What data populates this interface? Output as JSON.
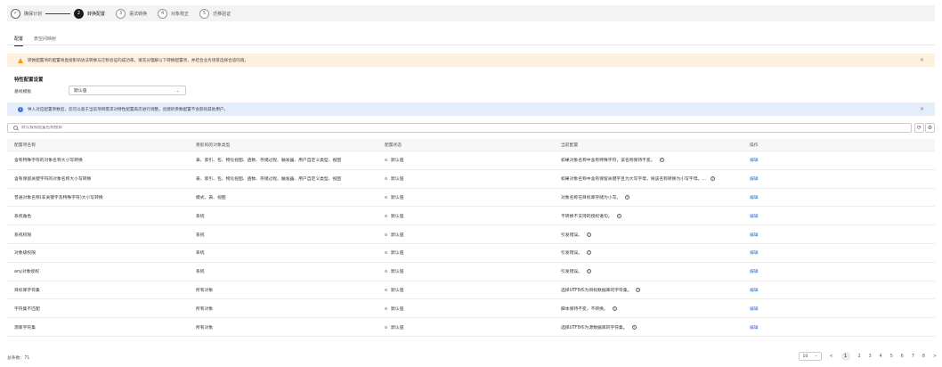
{
  "stepper": {
    "steps": [
      {
        "num": "✓",
        "label": "确保计划"
      },
      {
        "num": "2",
        "label": "转换配置"
      },
      {
        "num": "3",
        "label": "语法转换"
      },
      {
        "num": "4",
        "label": "对象校正"
      },
      {
        "num": "5",
        "label": "迁移验证"
      }
    ]
  },
  "tabs": [
    {
      "label": "配置"
    },
    {
      "label": "表空间映射"
    }
  ],
  "warning_banner": {
    "text": "转换配置项的配置将直接影响语法转换与迁移验证的成功率。请充分理解以下转换配置项，并结合业务场景选择合适的值。",
    "close": "×"
  },
  "section": {
    "title": "特性配置设置",
    "field_label": "基线模板",
    "select_value": "默认值",
    "select_chevron": "⌄"
  },
  "info_banner": {
    "icon": "i",
    "text": "导入对应配置参数后，您可以基于当前项目需求对特性配置再次进行调整，创建的参数配置不会影响其他用户。",
    "close": "×"
  },
  "search": {
    "placeholder": "默认按照配置名称搜索",
    "refresh_icon": "⟳",
    "settings_icon": "⚙"
  },
  "table": {
    "headers": [
      "配置项名称",
      "受影响的对象类型",
      "配置状态",
      "当前配置",
      "操作"
    ],
    "rows": [
      {
        "name": "含有特殊字符的对象名称大小写转换",
        "types": "表、索引、包、物化视图、函数、存储过程、触发器、用户自定义类型、视图",
        "status": "默认值",
        "current": "如果对象名称中含有特殊字符，该名称保持不变。",
        "help": "?",
        "action": "编辑"
      },
      {
        "name": "含有保留关键字符的对象名称大小写转换",
        "types": "表、索引、包、物化视图、函数、存储过程、触发器、用户自定义类型、视图",
        "status": "默认值",
        "current": "如果对象名称中含有保留关键字且为大写字母，将该名称转换为小写字母。...",
        "help": "?",
        "action": "编辑"
      },
      {
        "name": "普通对象名称(非关键字及特殊字符)大小写转换",
        "types": "模式、表、视图",
        "status": "默认值",
        "current": "对象名称在目标库存储为小写。",
        "help": "?",
        "action": "编辑"
      },
      {
        "name": "系统角色",
        "types": "系统",
        "status": "默认值",
        "current": "不转换不支持的授权语句。",
        "help": "?",
        "action": "编辑"
      },
      {
        "name": "系统权限",
        "types": "系统",
        "status": "默认值",
        "current": "引发错误。",
        "help": "?",
        "action": "编辑"
      },
      {
        "name": "对象级权限",
        "types": "系统",
        "status": "默认值",
        "current": "引发错误。",
        "help": "?",
        "action": "编辑"
      },
      {
        "name": "any对象授权",
        "types": "系统",
        "status": "默认值",
        "current": "引发错误。",
        "help": "?",
        "action": "编辑"
      },
      {
        "name": "目标库字符集",
        "types": "所有对象",
        "status": "默认值",
        "current": "选择UTF8作为目标数据库的字符集。",
        "help": "?",
        "action": "编辑"
      },
      {
        "name": "字符集不匹配",
        "types": "所有对象",
        "status": "默认值",
        "current": "脚本保持不变，不转换。",
        "help": "?",
        "action": "编辑"
      },
      {
        "name": "源库字符集",
        "types": "所有对象",
        "status": "默认值",
        "current": "选择UTF8作为源数据库的字符集。",
        "help": "?",
        "action": "编辑"
      }
    ]
  },
  "footer": {
    "total": "总条数：71",
    "page_size": "10",
    "prev": "<",
    "pages": [
      "1",
      "2",
      "3",
      "4",
      "5",
      "6",
      "7",
      "8",
      ">"
    ]
  }
}
